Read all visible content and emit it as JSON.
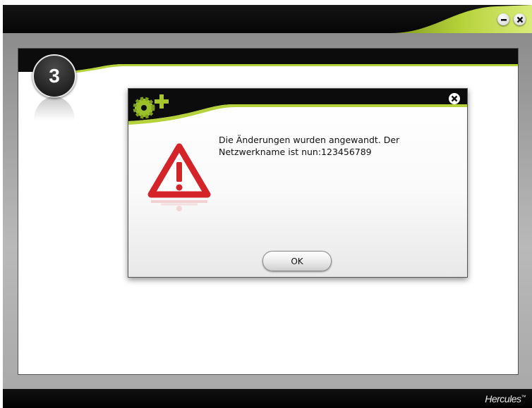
{
  "window": {
    "controls": {
      "minimize_icon": "minimize-icon",
      "close_icon": "close-icon"
    },
    "colors": {
      "frame": "#0b0b0b",
      "accent_green": "#a7c52e",
      "panel_bg": "#ffffff",
      "content_bg": "#a3a3a3"
    }
  },
  "stage": {
    "step_number": "3"
  },
  "dialog": {
    "header_icon": "gear-plus-icon",
    "close_icon": "close-icon",
    "warning_icon": "warning-triangle-icon",
    "warning_color": "#d4242a",
    "message_line1": "Die Änderungen wurden angewandt. Der",
    "message_line2": "Netzwerkname ist nun:123456789",
    "ok_label": "OK"
  },
  "footer": {
    "brand_name": "Hercules",
    "trademark": "™"
  }
}
